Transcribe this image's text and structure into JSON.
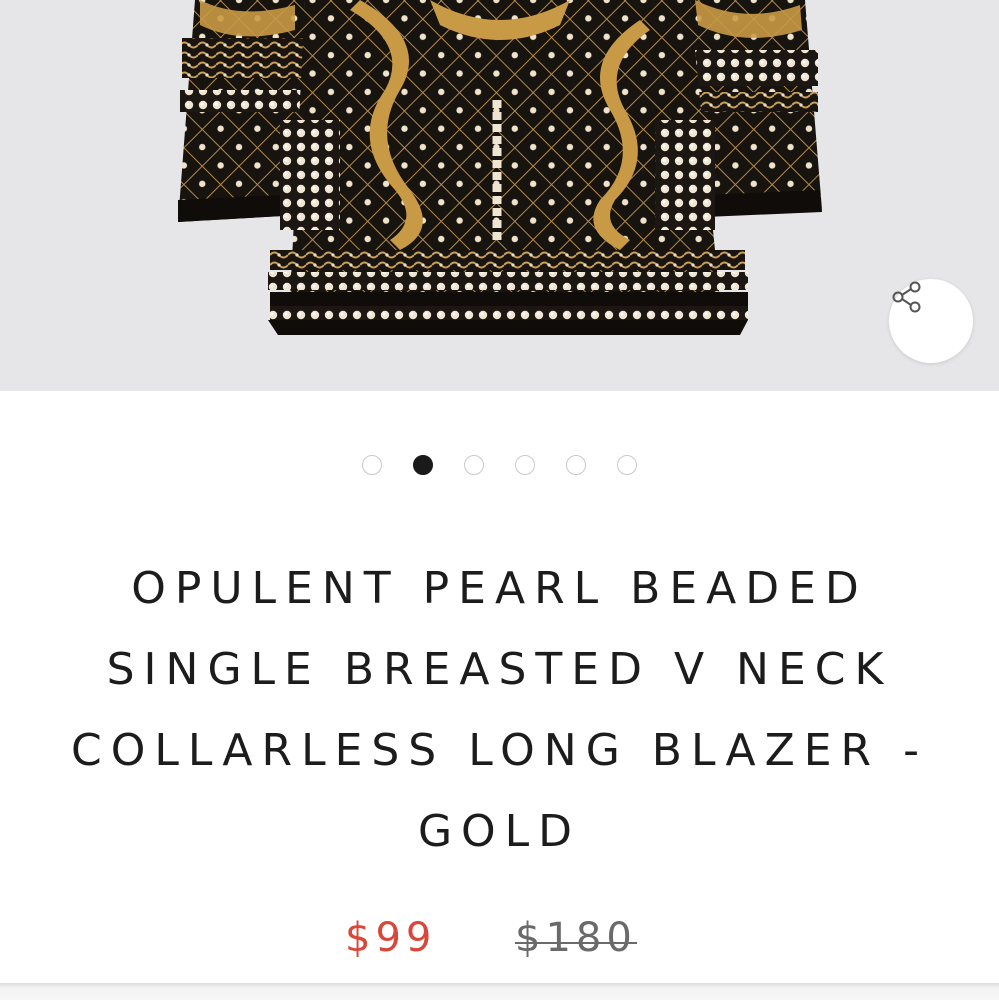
{
  "product": {
    "title": "OPULENT PEARL BEADED SINGLE BREASTED V NECK COLLARLESS LONG BLAZER - GOLD",
    "price_sale": "$99",
    "price_original": "$180"
  },
  "gallery": {
    "image_subject": "black blazer with gold embroidery and pearl beading",
    "share_icon": "share-icon",
    "dot_count": 6,
    "active_index": 1
  },
  "colors": {
    "sale_price": "#d9473b",
    "text": "#1c1c1c",
    "active_dot": "#1a1a1a",
    "image_background": "#e6e6e8"
  }
}
